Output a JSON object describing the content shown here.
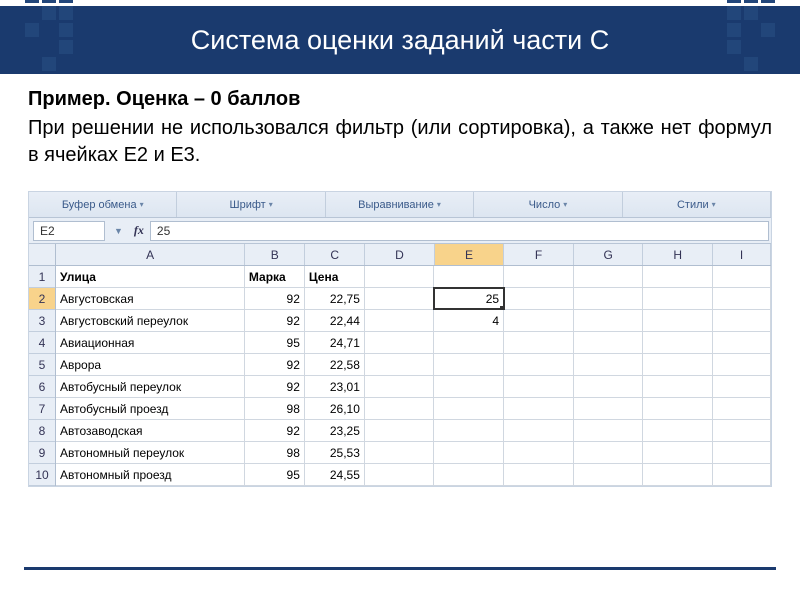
{
  "header": {
    "title": "Система оценки заданий части С"
  },
  "example": {
    "title": "Пример. Оценка – 0 баллов",
    "body": "При решении не использовался фильтр (или сортировка), а также нет формул в ячейках E2 и E3."
  },
  "ribbon": {
    "groups": [
      "Буфер обмена",
      "Шрифт",
      "Выравнивание",
      "Число",
      "Стили"
    ]
  },
  "name_box": {
    "ref": "E2",
    "fx_label": "fx",
    "formula": "25"
  },
  "columns": [
    "A",
    "B",
    "C",
    "D",
    "E",
    "F",
    "G",
    "H",
    "I"
  ],
  "col_widths": [
    "cw-A",
    "cw-B",
    "cw-C",
    "cw-D",
    "cw-E",
    "cw-F",
    "cw-G",
    "cw-H",
    "cw-I"
  ],
  "row_headers": [
    "1",
    "2",
    "3",
    "4",
    "5",
    "6",
    "7",
    "8",
    "9",
    "10"
  ],
  "selected": {
    "row": 2,
    "col": "E"
  },
  "rows": [
    {
      "hdr": true,
      "cells": [
        "Улица",
        "Марка",
        "Цена",
        "",
        "",
        "",
        "",
        "",
        ""
      ]
    },
    {
      "cells": [
        "Августовская",
        "92",
        "22,75",
        "",
        "25",
        "",
        "",
        "",
        ""
      ]
    },
    {
      "cells": [
        "Августовский переулок",
        "92",
        "22,44",
        "",
        "4",
        "",
        "",
        "",
        ""
      ]
    },
    {
      "cells": [
        "Авиационная",
        "95",
        "24,71",
        "",
        "",
        "",
        "",
        "",
        ""
      ]
    },
    {
      "cells": [
        "Аврора",
        "92",
        "22,58",
        "",
        "",
        "",
        "",
        "",
        ""
      ]
    },
    {
      "cells": [
        "Автобусный переулок",
        "92",
        "23,01",
        "",
        "",
        "",
        "",
        "",
        ""
      ]
    },
    {
      "cells": [
        "Автобусный проезд",
        "98",
        "26,10",
        "",
        "",
        "",
        "",
        "",
        ""
      ]
    },
    {
      "cells": [
        "Автозаводская",
        "92",
        "23,25",
        "",
        "",
        "",
        "",
        "",
        ""
      ]
    },
    {
      "cells": [
        "Автономный переулок",
        "98",
        "25,53",
        "",
        "",
        "",
        "",
        "",
        ""
      ]
    },
    {
      "cells": [
        "Автономный проезд",
        "95",
        "24,55",
        "",
        "",
        "",
        "",
        "",
        ""
      ]
    }
  ]
}
